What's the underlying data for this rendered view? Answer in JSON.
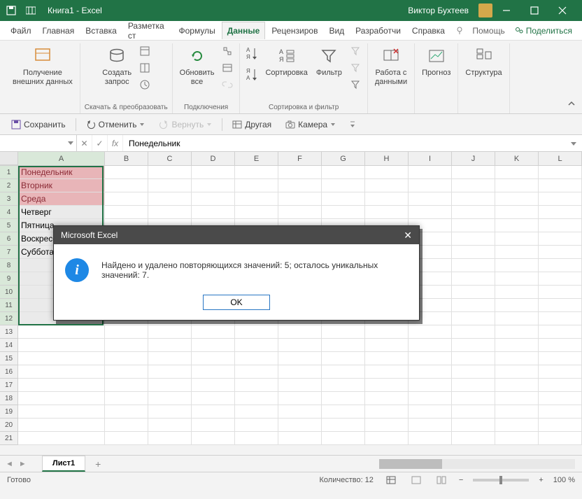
{
  "titlebar": {
    "title": "Книга1 - Excel",
    "user": "Виктор Бухтеев"
  },
  "menubar": {
    "tabs": [
      "Файл",
      "Главная",
      "Вставка",
      "Разметка ст",
      "Формулы",
      "Данные",
      "Рецензиров",
      "Вид",
      "Разработчи",
      "Справка"
    ],
    "active": "Данные",
    "help": "Помощь",
    "share": "Поделиться"
  },
  "ribbon": {
    "group1": {
      "btn": "Получение\nвнешних данных",
      "label": ""
    },
    "group2": {
      "btn": "Создать\nзапрос",
      "label": "Скачать & преобразовать"
    },
    "group3": {
      "btn": "Обновить\nвсе",
      "label": "Подключения"
    },
    "group4": {
      "sort": "Сортировка",
      "filter": "Фильтр",
      "label": "Сортировка и фильтр"
    },
    "group5": {
      "btn": "Работа с\nданными"
    },
    "group6": {
      "btn": "Прогноз"
    },
    "group7": {
      "btn": "Структура"
    }
  },
  "qat": {
    "save": "Сохранить",
    "undo": "Отменить",
    "redo": "Вернуть",
    "other": "Другая",
    "camera": "Камера"
  },
  "formula": {
    "namebox": "",
    "value": "Понедельник",
    "fx": "fx"
  },
  "columns": [
    "A",
    "B",
    "C",
    "D",
    "E",
    "F",
    "G",
    "H",
    "I",
    "J",
    "K",
    "L"
  ],
  "rows_data": [
    {
      "n": "1",
      "v": "Понедельник",
      "red": true
    },
    {
      "n": "2",
      "v": "Вторник",
      "red": true
    },
    {
      "n": "3",
      "v": "Среда",
      "red": true
    },
    {
      "n": "4",
      "v": "Четверг",
      "red": false
    },
    {
      "n": "5",
      "v": "Пятница",
      "red": false
    },
    {
      "n": "6",
      "v": "Воскресенье",
      "red": false
    },
    {
      "n": "7",
      "v": "Суббота",
      "red": false
    },
    {
      "n": "8",
      "v": "",
      "red": false
    },
    {
      "n": "9",
      "v": "",
      "red": false
    },
    {
      "n": "10",
      "v": "",
      "red": false
    },
    {
      "n": "11",
      "v": "",
      "red": false
    },
    {
      "n": "12",
      "v": "",
      "red": false
    }
  ],
  "extra_rows": [
    "13",
    "14",
    "15",
    "16",
    "17",
    "18",
    "19",
    "20",
    "21"
  ],
  "sheet": {
    "tab": "Лист1"
  },
  "statusbar": {
    "ready": "Готово",
    "count": "Количество: 12",
    "zoom": "100 %"
  },
  "dialog": {
    "title": "Microsoft Excel",
    "message": "Найдено и удалено повторяющихся значений: 5; осталось уникальных значений: 7.",
    "ok": "OK"
  }
}
